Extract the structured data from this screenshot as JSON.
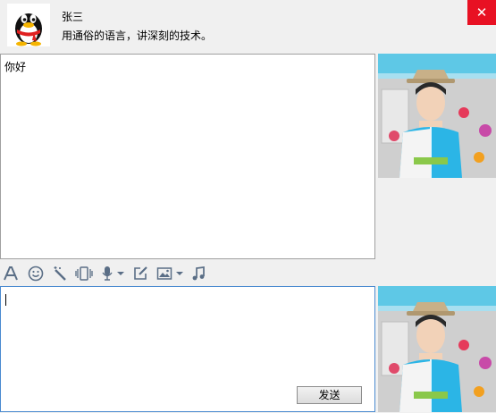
{
  "window": {
    "close_glyph": "✕",
    "close_color": "#e81123"
  },
  "contact": {
    "name": "张三",
    "signature": "用通俗的语言，讲深刻的技术。"
  },
  "messages": [
    {
      "text": "你好"
    }
  ],
  "toolbar": {
    "items": [
      "font-icon",
      "emoji-icon",
      "magic-wand-icon",
      "shake-icon",
      "voice-icon",
      "voice-dropdown-icon",
      "edit-icon",
      "image-icon",
      "image-dropdown-icon",
      "music-icon"
    ]
  },
  "input": {
    "value": "",
    "send_label": "发送"
  },
  "colors": {
    "accent": "#4a8ad0",
    "toolbar_icon": "#5a6e86"
  }
}
